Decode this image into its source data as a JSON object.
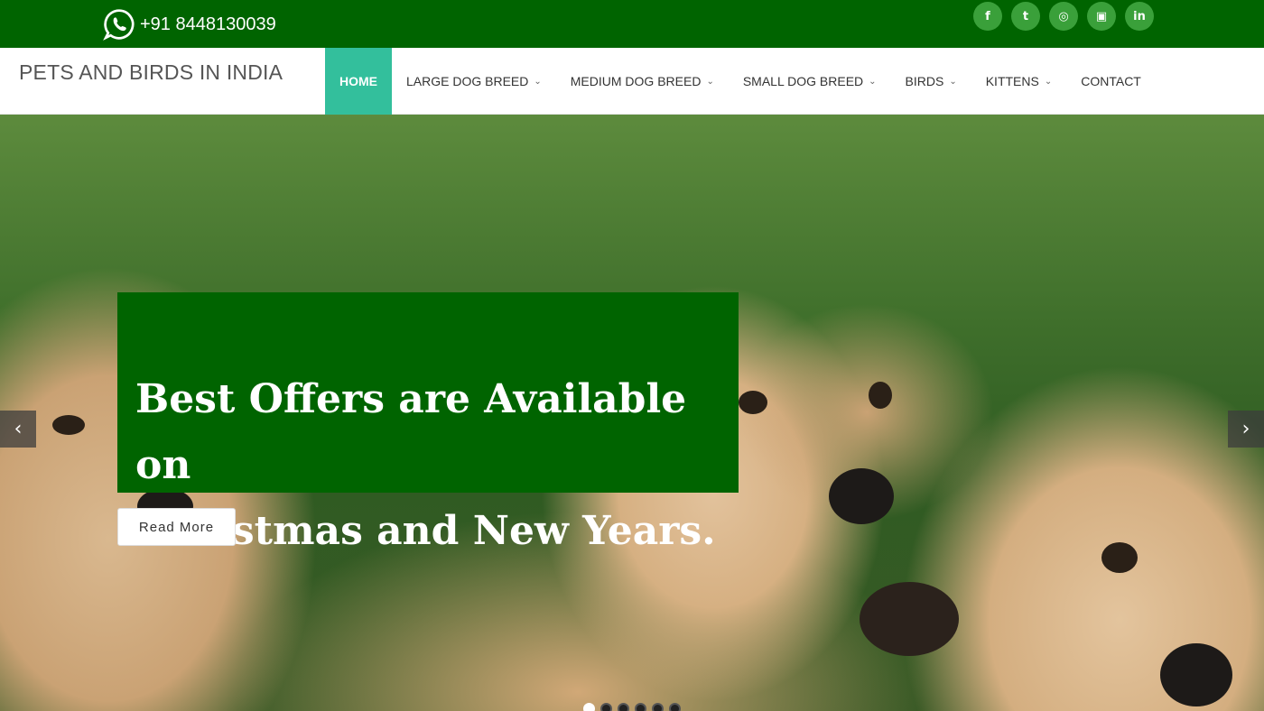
{
  "topbar": {
    "phone": "+91 8448130039",
    "phone_icon": "whatsapp-icon",
    "socials": [
      {
        "name": "facebook-icon",
        "glyph": "f"
      },
      {
        "name": "twitter-icon",
        "glyph": "t"
      },
      {
        "name": "dribbble-icon",
        "glyph": "◎"
      },
      {
        "name": "instagram-icon",
        "glyph": "▣"
      },
      {
        "name": "linkedin-icon",
        "glyph": "in"
      }
    ],
    "colors": {
      "background": "#006400",
      "social_bg": "#3aa03a"
    }
  },
  "header": {
    "brand": "PETS AND BIRDS IN INDIA",
    "nav": [
      {
        "label": "HOME",
        "active": true,
        "dropdown": false
      },
      {
        "label": "LARGE DOG BREED",
        "active": false,
        "dropdown": true
      },
      {
        "label": "MEDIUM DOG BREED",
        "active": false,
        "dropdown": true
      },
      {
        "label": "SMALL DOG BREED",
        "active": false,
        "dropdown": true
      },
      {
        "label": "BIRDS",
        "active": false,
        "dropdown": true
      },
      {
        "label": "KITTENS",
        "active": false,
        "dropdown": true
      },
      {
        "label": "CONTACT",
        "active": false,
        "dropdown": false
      }
    ],
    "active_color": "#33bf9c"
  },
  "hero": {
    "caption_line1": "Best Offers are Available on",
    "caption_line2": "Christmas and New Years.",
    "read_more": "Read More",
    "prev_glyph": "‹",
    "next_glyph": "›",
    "slide_count": 6,
    "active_slide": 1,
    "caption_bg": "#006400"
  }
}
